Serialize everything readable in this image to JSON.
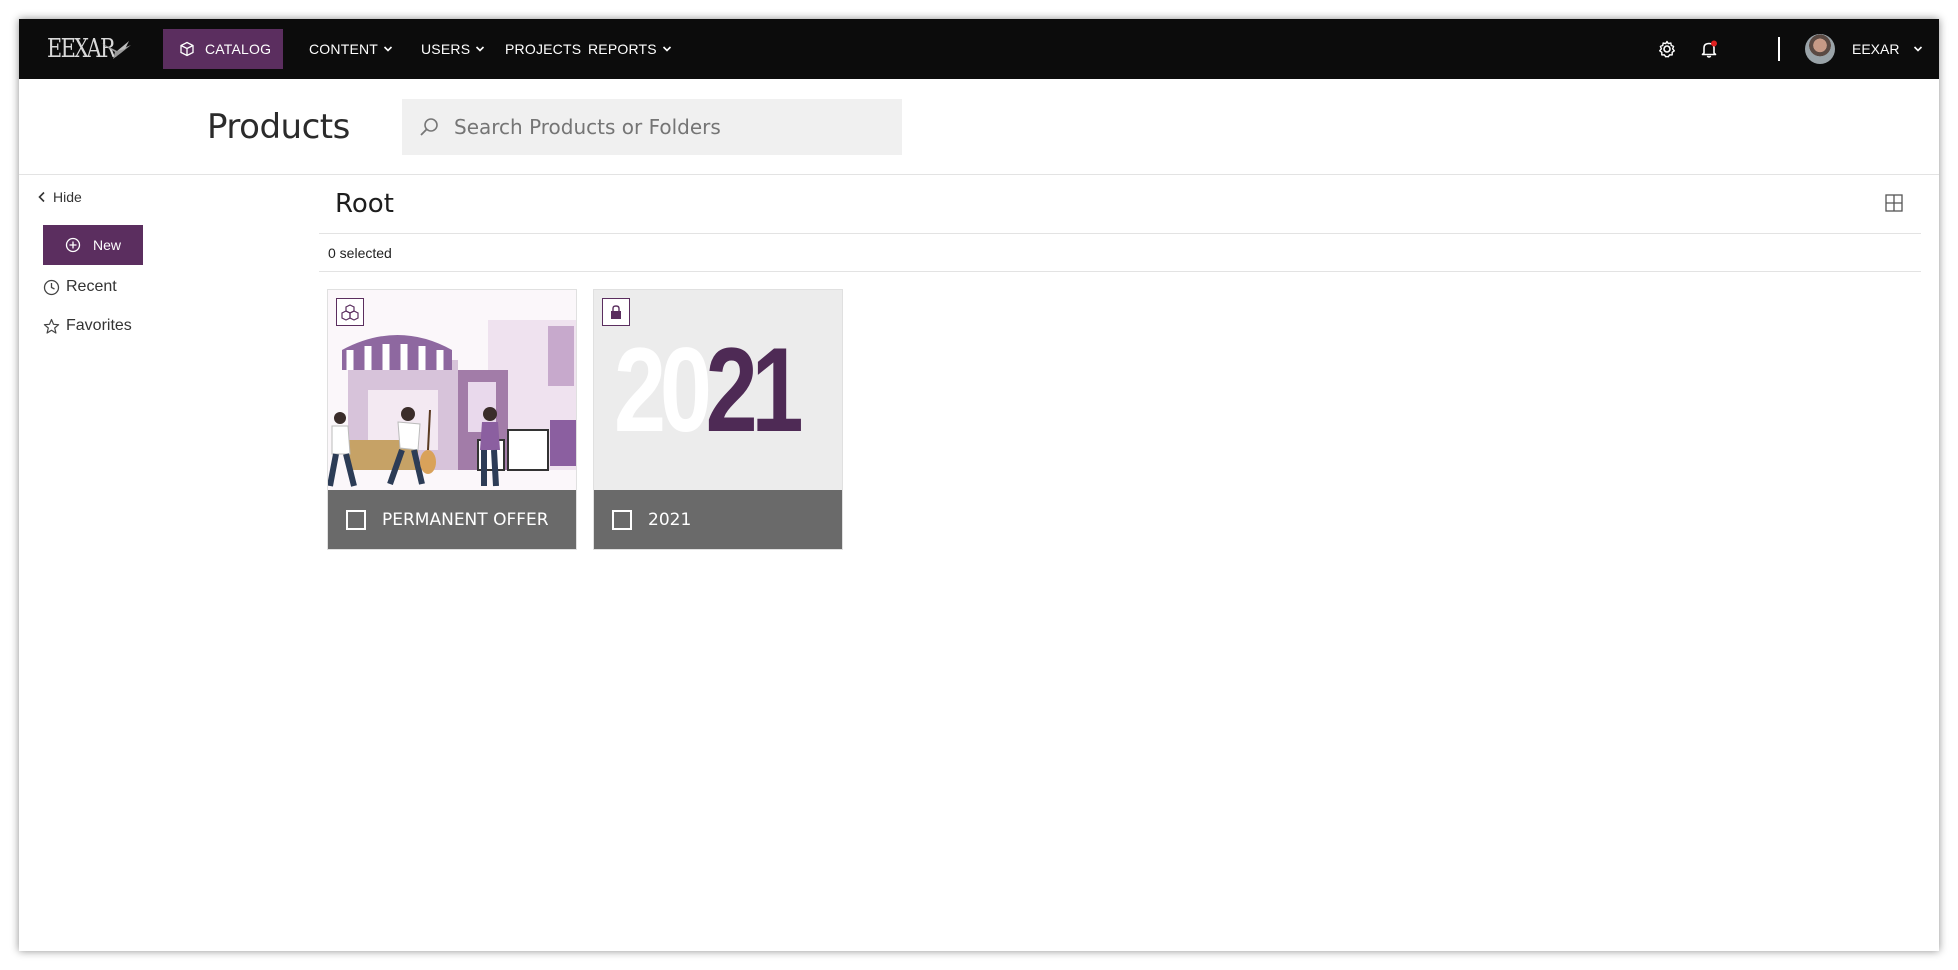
{
  "nav": {
    "logo_text": "EEXAR",
    "catalog_label": "CATALOG",
    "items": [
      {
        "label": "CONTENT",
        "has_dropdown": true
      },
      {
        "label": "USERS",
        "has_dropdown": true
      },
      {
        "label": "PROJECTS",
        "has_dropdown": false
      },
      {
        "label": "REPORTS",
        "has_dropdown": true
      }
    ],
    "user_name": "EEXAR"
  },
  "header": {
    "title": "Products",
    "search_placeholder": "Search Products or Folders"
  },
  "sidebar": {
    "hide_label": "Hide",
    "new_label": "New",
    "items": [
      {
        "label": "Recent",
        "icon": "clock-icon"
      },
      {
        "label": "Favorites",
        "icon": "star-icon"
      }
    ]
  },
  "main": {
    "breadcrumb": "Root",
    "selected_count": "0 selected",
    "cards": [
      {
        "label": "PERMANENT OFFER",
        "badge_icon": "products-icon"
      },
      {
        "label": "2021",
        "badge_icon": "lock-icon",
        "art_text_light": "20",
        "art_text_dark": "21"
      }
    ]
  },
  "colors": {
    "accent": "#5b2e5f",
    "navbar": "#0c0c0c",
    "card_footer": "#6a6a6a",
    "notification_dot": "#e02020"
  }
}
